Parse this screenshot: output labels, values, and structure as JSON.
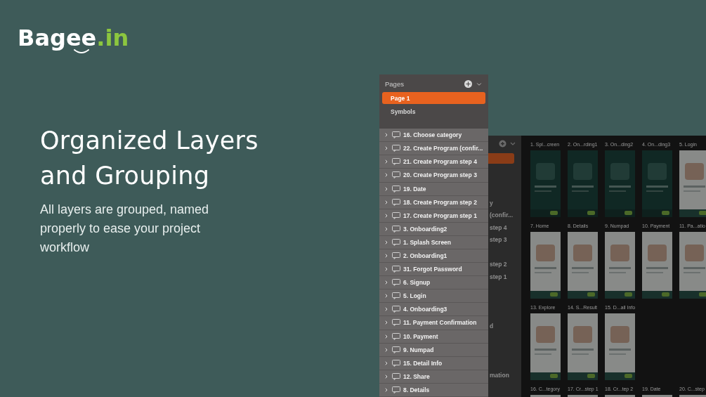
{
  "logo": {
    "name": "Bagee",
    "suffix": ".in"
  },
  "headline": "Organized Layers and Grouping",
  "description": "All layers are grouped, named properly to ease your project workflow",
  "back_window": {
    "layer_texts": [
      {
        "kind": "text",
        "text": "y"
      },
      {
        "kind": "text",
        "text": "(confir..."
      },
      {
        "kind": "text",
        "text": "step 4"
      },
      {
        "kind": "text",
        "text": "step 3"
      },
      {
        "kind": "blank"
      },
      {
        "kind": "text",
        "text": "step 2"
      },
      {
        "kind": "text",
        "text": "step 1"
      },
      {
        "kind": "blank"
      },
      {
        "kind": "blank"
      },
      {
        "kind": "blank"
      },
      {
        "kind": "text",
        "text": "d"
      },
      {
        "kind": "blank"
      },
      {
        "kind": "blank"
      },
      {
        "kind": "blank"
      },
      {
        "kind": "text",
        "text": "mation"
      }
    ],
    "artboard_rows": [
      [
        {
          "label": "1. Spl...creen",
          "kind": "dark"
        },
        {
          "label": "2. On...rding1",
          "kind": "dark"
        },
        {
          "label": "3. On...ding2",
          "kind": "dark"
        },
        {
          "label": "4. On...ding3",
          "kind": "dark"
        },
        {
          "label": "5. Login",
          "kind": "light"
        }
      ],
      [
        {
          "label": "7. Home",
          "kind": "light"
        },
        {
          "label": "8. Details",
          "kind": "light"
        },
        {
          "label": "9. Numpad",
          "kind": "light"
        },
        {
          "label": "10. Payment",
          "kind": "light"
        },
        {
          "label": "11. Pa...atio",
          "kind": "light"
        }
      ],
      [
        {
          "label": "13. Explore",
          "kind": "light"
        },
        {
          "label": "14. S...Result",
          "kind": "light"
        },
        {
          "label": "15. D...all Info",
          "kind": "light"
        }
      ],
      [
        {
          "label": "16. C...tegory",
          "kind": "light"
        },
        {
          "label": "17. Cr...step 1",
          "kind": "light"
        },
        {
          "label": "18. Cr...tep 2",
          "kind": "light"
        },
        {
          "label": "19. Date",
          "kind": "light"
        },
        {
          "label": "20. C...step",
          "kind": "light"
        }
      ]
    ]
  },
  "pages_panel": {
    "title": "Pages",
    "pages": [
      {
        "label": "Page 1",
        "selected": true
      },
      {
        "label": "Symbols",
        "selected": false
      }
    ],
    "layers": [
      {
        "label": "16. Choose category"
      },
      {
        "label": "22. Create Program (confir..."
      },
      {
        "label": "21. Create Program step 4"
      },
      {
        "label": "20. Create Program step 3"
      },
      {
        "label": "19. Date"
      },
      {
        "label": "18. Create Program step 2"
      },
      {
        "label": "17. Create Program step 1"
      },
      {
        "label": "3. Onboarding2"
      },
      {
        "label": "1. Splash Screen"
      },
      {
        "label": "2. Onboarding1"
      },
      {
        "label": "31. Forgot Password"
      },
      {
        "label": "6. Signup"
      },
      {
        "label": "5. Login"
      },
      {
        "label": "4. Onboarding3"
      },
      {
        "label": "11. Payment Confirmation"
      },
      {
        "label": "10. Payment"
      },
      {
        "label": "9. Numpad"
      },
      {
        "label": "15. Detail Info"
      },
      {
        "label": "12. Share"
      },
      {
        "label": "8. Details"
      }
    ]
  }
}
